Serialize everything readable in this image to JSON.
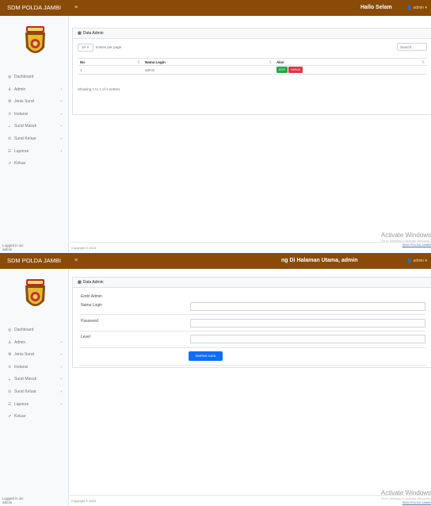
{
  "app": {
    "brand": "SDM POLDA JAMBI",
    "toggle_icon": "≡",
    "user_name": "admin",
    "user_caret": "▾",
    "user_glyph": "👤",
    "logged_in": "Logged in as:",
    "logged_user": "admin",
    "footer": "Copyright © 2023"
  },
  "sidebar": {
    "items": [
      {
        "label": "Dashboard",
        "icon": "dashboard-icon",
        "glyph": "◎",
        "chevron": ""
      },
      {
        "label": "Admin",
        "icon": "user-icon",
        "glyph": "♙",
        "chevron": "›"
      },
      {
        "label": "Jenis Surat",
        "icon": "gear-icon",
        "glyph": "⚙",
        "chevron": "›"
      },
      {
        "label": "Instansi",
        "icon": "building-icon",
        "glyph": "♕",
        "chevron": "›"
      },
      {
        "label": "Surat Masuk",
        "icon": "inbox-icon",
        "glyph": "⌄",
        "chevron": "›"
      },
      {
        "label": "Surat Keluar",
        "icon": "outbox-icon",
        "glyph": "⊙",
        "chevron": "›"
      },
      {
        "label": "Laporan",
        "icon": "report-icon",
        "glyph": "☷",
        "chevron": "›"
      },
      {
        "label": "Keluar",
        "icon": "logout-icon",
        "glyph": "⇗",
        "chevron": ""
      }
    ]
  },
  "screen1": {
    "greeting": "Hallo Selam",
    "card_title": "Data Admin",
    "card_icon": "▦",
    "length_value": "10",
    "length_caret": "∨",
    "length_suffix": "entries per page",
    "search_placeholder": "Search...",
    "columns": [
      "No",
      "Nama Login",
      "Aksi"
    ],
    "sort_glyph": "⇅",
    "rows": [
      {
        "no": "1",
        "name": "admin",
        "edit": "EDIT",
        "delete": "HAPUS"
      }
    ],
    "info": "Showing 1 to 1 of 1 entries"
  },
  "screen2": {
    "greeting": "ng Di Halaman Utama, admin",
    "card_title": "Data Admin",
    "card_icon": "▦",
    "form_title": "Emtri Admin",
    "fields": [
      {
        "label": "Nama Login",
        "value": ""
      },
      {
        "label": "Password",
        "value": ""
      },
      {
        "label": "Level",
        "value": ""
      }
    ],
    "save_label": "SIMPAN DATA"
  },
  "windows_watermark": {
    "title": "Activate Windows",
    "subtitle": "Go to Settings to activate Windows.",
    "link": "SDM POLDA JAMBI"
  },
  "colors": {
    "topbar": "#8a4b08",
    "sidebar": "#f8f9fa",
    "edit_button": "#28a745",
    "delete_button": "#dc3545",
    "save_button": "#0d6efd"
  }
}
